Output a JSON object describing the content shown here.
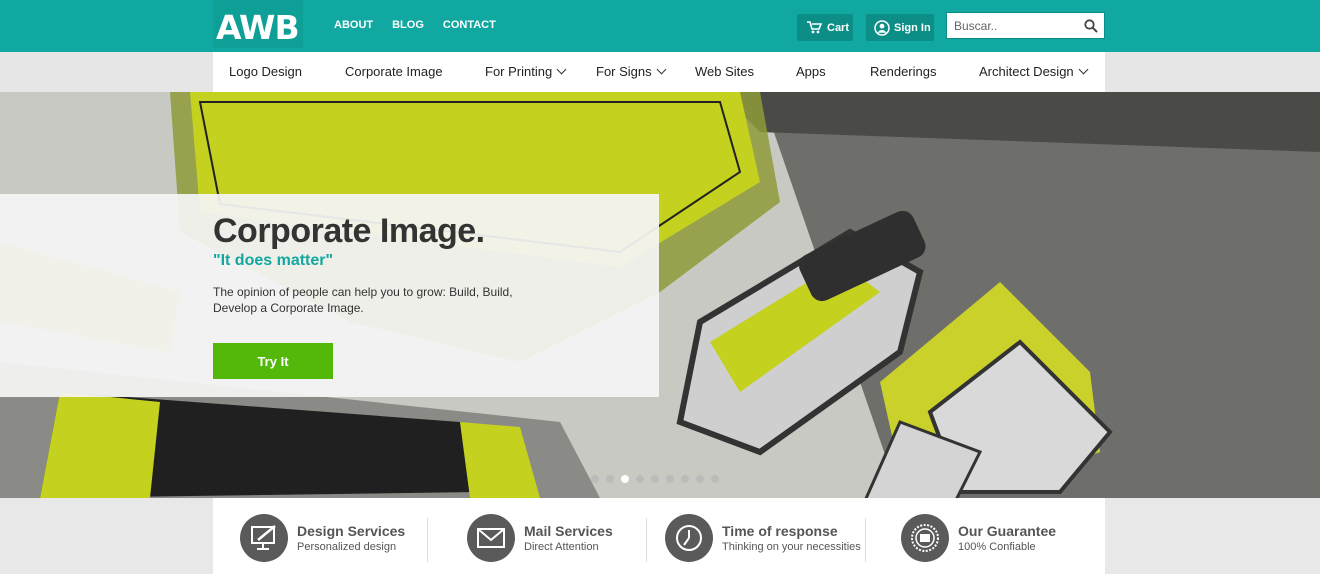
{
  "brand": {
    "logo": "AWB"
  },
  "topnav": {
    "about": "ABOUT",
    "blog": "BLOG",
    "contact": "CONTACT"
  },
  "header": {
    "cart_label": "Cart",
    "signin_label": "Sign In",
    "search_placeholder": "Buscar.."
  },
  "nav": {
    "items": [
      {
        "label": "Logo Design"
      },
      {
        "label": "Corporate Image"
      },
      {
        "label": "For Printing"
      },
      {
        "label": "For Signs"
      },
      {
        "label": "Web Sites"
      },
      {
        "label": "Apps"
      },
      {
        "label": "Renderings"
      },
      {
        "label": "Architect Design"
      }
    ]
  },
  "hero": {
    "title": "Corporate Image.",
    "subtitle": "\"It does matter\"",
    "text": "The opinion of people can help you to grow: Build, Build, Develop a Corporate Image.",
    "button": "Try It",
    "slides_total": 9,
    "active_slide": 3
  },
  "features": [
    {
      "title": "Design Services",
      "subtitle": "Personalized design",
      "icon": "monitor-pen-icon"
    },
    {
      "title": "Mail Services",
      "subtitle": "Direct Attention",
      "icon": "envelope-icon"
    },
    {
      "title": "Time of response",
      "subtitle": "Thinking on your necessities",
      "icon": "clock-icon"
    },
    {
      "title": "Our Guarantee",
      "subtitle": "100% Confiable",
      "icon": "guarantee-seal-icon"
    }
  ],
  "colors": {
    "teal": "#10a8a0",
    "green": "#54b80a",
    "dark": "#333333"
  }
}
